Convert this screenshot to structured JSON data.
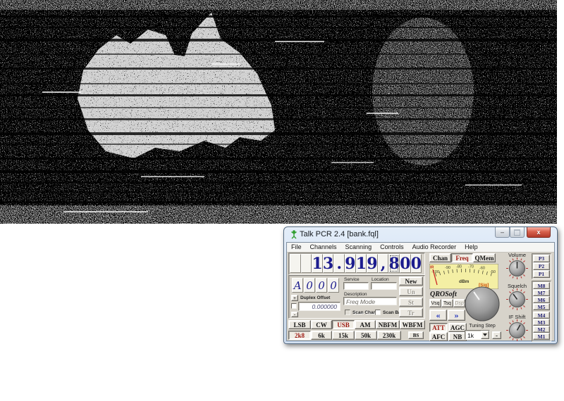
{
  "noise_panel": {
    "description": "Weak-signal radiofax/SSTV static: black frame filled with white speckle noise, horizontal interference streaks and a brighter speckled silhouette of Australia"
  },
  "win": {
    "title": "Talk PCR 2.4 [bank.fql]",
    "caption": {
      "minimize": "–",
      "close": "x"
    },
    "menu": [
      "File",
      "Channels",
      "Scanning",
      "Controls",
      "Audio Recorder",
      "Help"
    ],
    "freq_digits": [
      "",
      "",
      "1",
      "3",
      ".",
      "9",
      "1",
      "9",
      ",",
      "8",
      "0",
      "0"
    ],
    "channel": {
      "cells": [
        "A",
        "0",
        "0",
        "0"
      ],
      "plus": "+",
      "minus": "-",
      "duplex_label": "Duplex Offset",
      "duplex_value": "0.000000",
      "service_label": "Service",
      "location_label": "Location",
      "description_label": "Description",
      "description_value": "Freq Mode",
      "scan_chan": "Scan Chan",
      "scan_bank": "Scan Bank",
      "btn_new": "New",
      "btn_un": "Un",
      "btn_st": "St",
      "btn_tr": "Tr"
    },
    "modes": [
      "LSB",
      "CW",
      "USB",
      "AM",
      "NBFM",
      "WBFM"
    ],
    "active_mode": "USB",
    "filters": [
      "2k8",
      "6k",
      "15k",
      "50k",
      "230k"
    ],
    "active_filter": "2k8",
    "bs": "BS",
    "tabs": [
      "Chan",
      "Freq",
      "QMem"
    ],
    "active_tab": "Freq",
    "meter": {
      "corner": "IR",
      "labels": [
        "-100",
        "-90",
        "-80",
        "-70",
        "-60",
        "-50"
      ],
      "unit": "dBm",
      "sig": "[Sig]"
    },
    "brand": "QROSoft",
    "sq_buttons": [
      "Vsq",
      "Tsq",
      "Dsp"
    ],
    "arrow_left": "«",
    "arrow_right": "»",
    "dsp_buttons": [
      "ATT",
      "AGC",
      "AFC",
      "NB"
    ],
    "active_dsp": "ATT",
    "tuning_label": "Tuning Step",
    "tuning_value": "1k",
    "tuning_minus": "-",
    "knobs": [
      "Volume",
      "Squelch",
      "IF Shift"
    ],
    "presets": [
      "P3",
      "P2",
      "P1"
    ],
    "memories": [
      "M8",
      "M7",
      "M6",
      "M5",
      "M4",
      "M3",
      "M2",
      "M1"
    ],
    "colors": {
      "accent_red": "#9c1810",
      "digit_blue": "#1c1c8e",
      "meter_bg": "#f4efa4",
      "sig_orange": "#cc4a00"
    }
  }
}
